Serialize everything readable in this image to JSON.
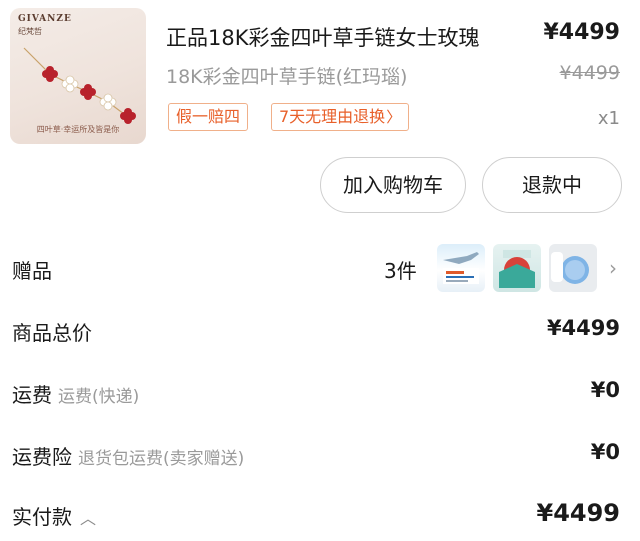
{
  "product": {
    "brand": "GIVANZE",
    "brand_cn": "纪梵哲",
    "thumb_caption": "四叶草·幸运所及皆是你",
    "title": "正品18K彩金四叶草手链女士玫瑰",
    "price": "¥4499",
    "variant": "18K彩金四叶草手链(红玛瑙)",
    "original_price": "¥4499",
    "tags": [
      "假一赔四",
      "7天无理由退换"
    ],
    "quantity": "x1"
  },
  "actions": {
    "add_to_cart": "加入购物车",
    "refund_status": "退款中"
  },
  "gifts": {
    "label": "赠品",
    "count": "3件",
    "images": [
      "gift-image-1",
      "gift-image-2",
      "gift-image-3"
    ]
  },
  "summary": {
    "total_label": "商品总价",
    "total_value": "¥4499",
    "shipping_label": "运费",
    "shipping_sub": "运费(快递)",
    "shipping_value": "¥0",
    "insurance_label": "运费险",
    "insurance_sub": "退货包运费(卖家赠送)",
    "insurance_value": "¥0",
    "paid_label": "实付款",
    "paid_value": "¥4499"
  },
  "colors": {
    "tag_text": "#e8602a",
    "tag_border": "#f0b08a",
    "muted": "#9a9a9a"
  }
}
